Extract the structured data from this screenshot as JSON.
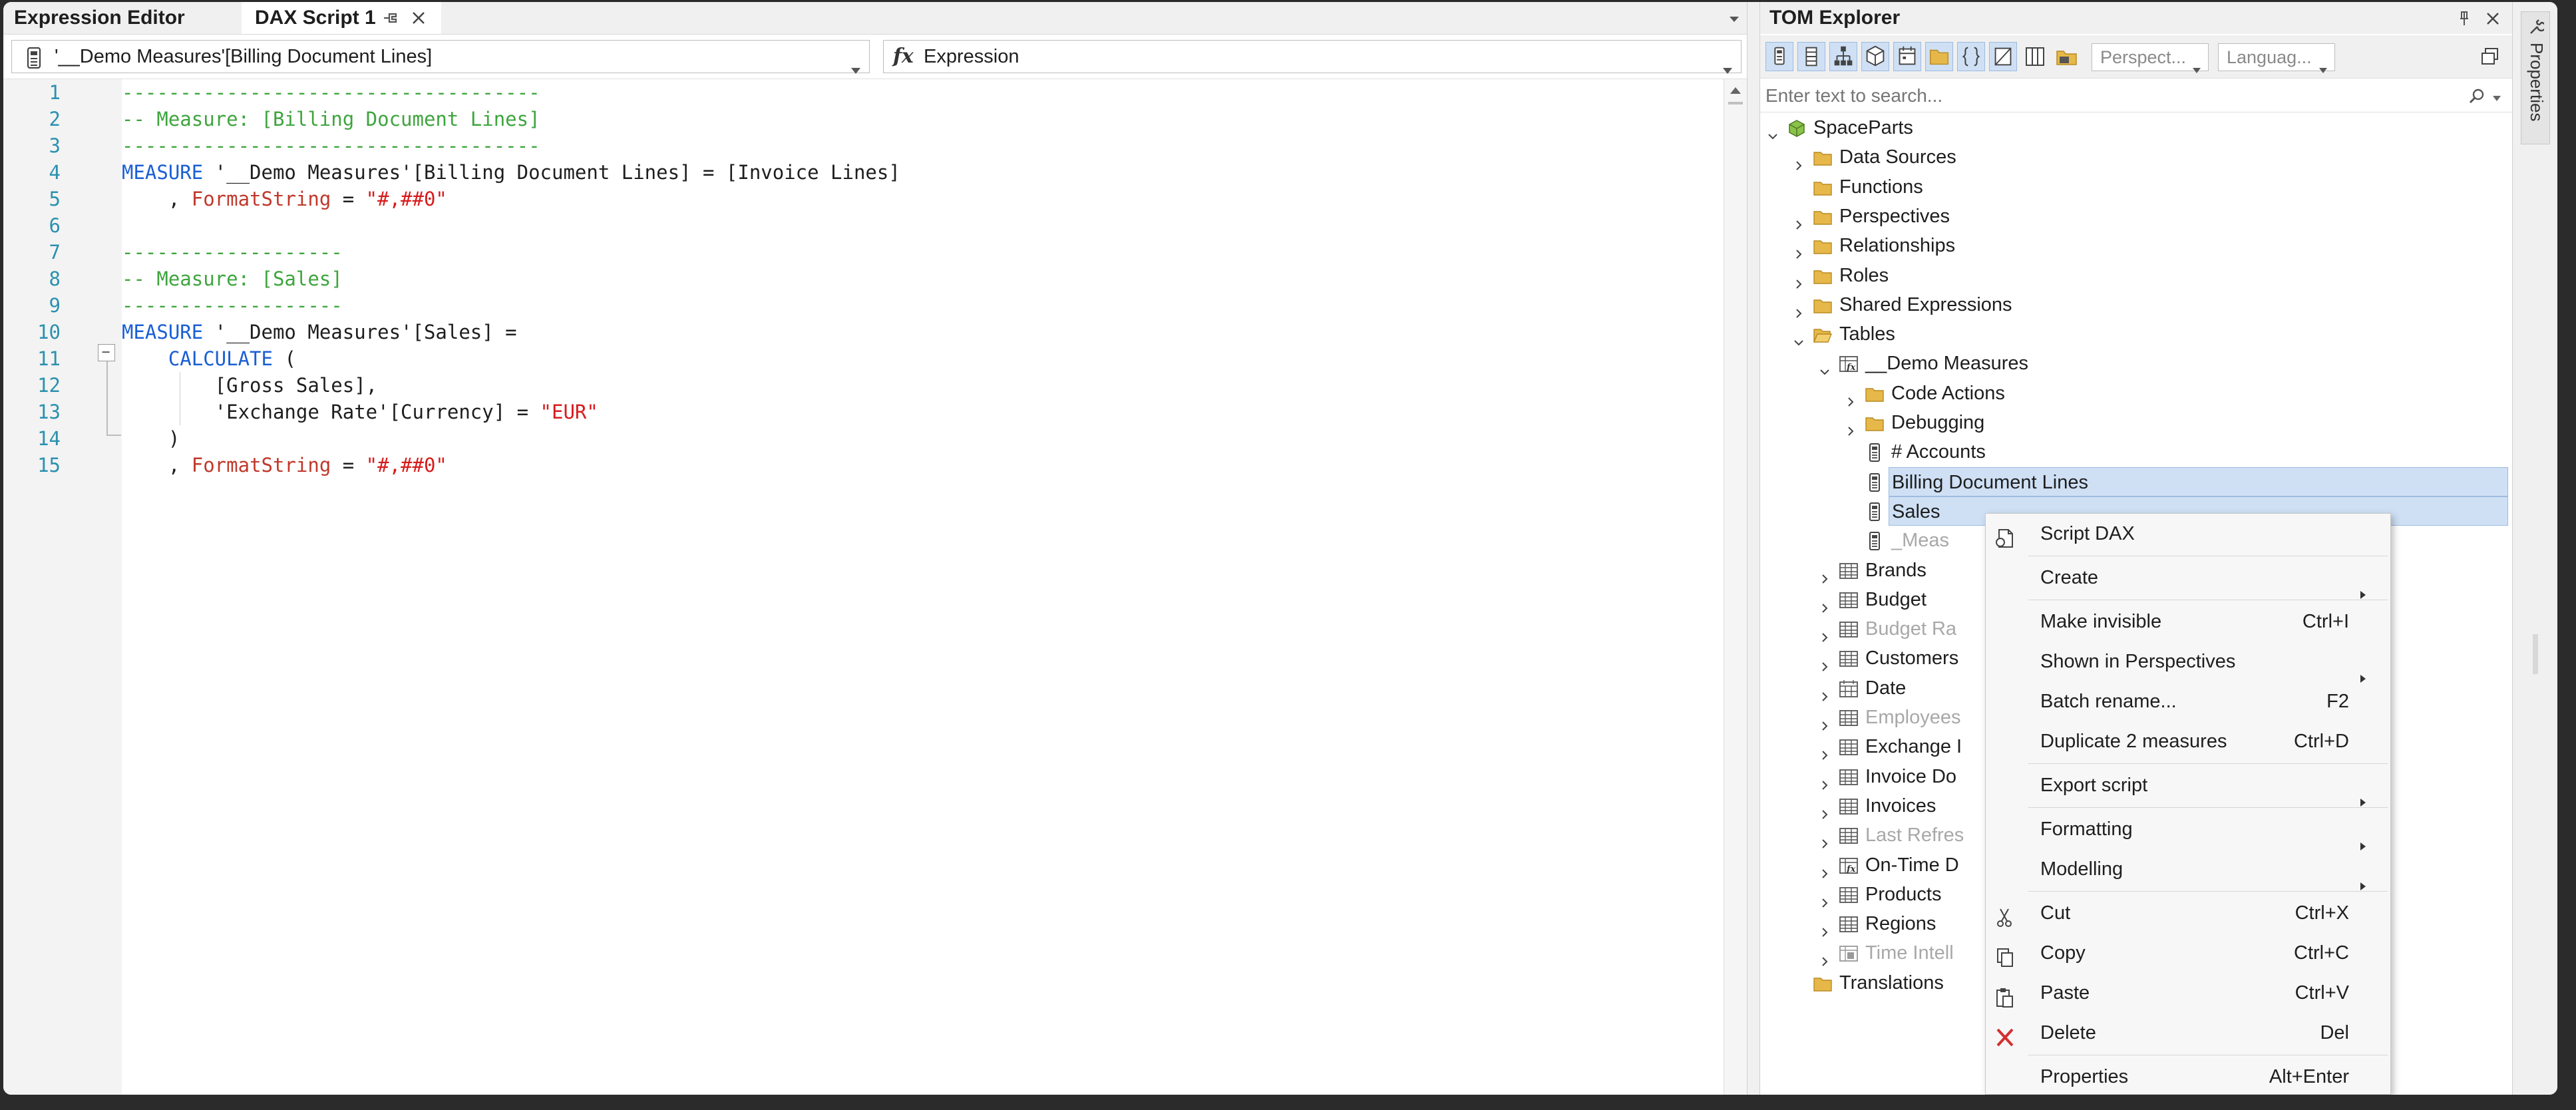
{
  "editor": {
    "tabs": [
      {
        "label": "Expression Editor"
      },
      {
        "label": "DAX Script 1"
      }
    ],
    "object_combo_value": "'__Demo Measures'[Billing Document Lines]",
    "property_combo_value": "Expression",
    "property_combo_icon": "fx"
  },
  "code": {
    "line_numbers": [
      "1",
      "2",
      "3",
      "4",
      "5",
      "6",
      "7",
      "8",
      "9",
      "10",
      "11",
      "12",
      "13",
      "14",
      "15"
    ],
    "lines": [
      [
        {
          "t": "------------------------------------",
          "c": "cm"
        }
      ],
      [
        {
          "t": "-- Measure: [Billing Document Lines]",
          "c": "cm"
        }
      ],
      [
        {
          "t": "------------------------------------",
          "c": "cm"
        }
      ],
      [
        {
          "t": "MEASURE",
          "c": "kw"
        },
        {
          "t": " '__Demo Measures'[Billing Document Lines] = [Invoice Lines]",
          "c": ""
        }
      ],
      [
        {
          "t": "    , ",
          "c": ""
        },
        {
          "t": "FormatString",
          "c": "prop"
        },
        {
          "t": " = ",
          "c": ""
        },
        {
          "t": "\"#,##0\"",
          "c": "str"
        }
      ],
      [
        {
          "t": "",
          "c": ""
        }
      ],
      [
        {
          "t": "-------------------",
          "c": "cm"
        }
      ],
      [
        {
          "t": "-- Measure: [Sales]",
          "c": "cm"
        }
      ],
      [
        {
          "t": "-------------------",
          "c": "cm"
        }
      ],
      [
        {
          "t": "MEASURE",
          "c": "kw"
        },
        {
          "t": " '__Demo Measures'[Sales] =",
          "c": ""
        }
      ],
      [
        {
          "t": "    ",
          "c": ""
        },
        {
          "t": "CALCULATE",
          "c": "fn"
        },
        {
          "t": " (",
          "c": ""
        }
      ],
      [
        {
          "t": "        [Gross Sales],",
          "c": ""
        }
      ],
      [
        {
          "t": "        'Exchange Rate'[Currency] = ",
          "c": ""
        },
        {
          "t": "\"EUR\"",
          "c": "str"
        }
      ],
      [
        {
          "t": "    )",
          "c": ""
        }
      ],
      [
        {
          "t": "    , ",
          "c": ""
        },
        {
          "t": "FormatString",
          "c": "prop"
        },
        {
          "t": " = ",
          "c": ""
        },
        {
          "t": "\"#,##0\"",
          "c": "str"
        }
      ]
    ]
  },
  "tom": {
    "title": "TOM Explorer",
    "perspective_placeholder": "Perspect...",
    "language_placeholder": "Languag...",
    "search_placeholder": "Enter text to search...",
    "tree": [
      {
        "label": "SpaceParts",
        "level": 0,
        "exp": "down",
        "icon": "model-icon"
      },
      {
        "label": "Data Sources",
        "level": 1,
        "exp": "right",
        "icon": "folder-icon"
      },
      {
        "label": "Functions",
        "level": 1,
        "exp": "",
        "icon": "folder-icon"
      },
      {
        "label": "Perspectives",
        "level": 1,
        "exp": "right",
        "icon": "folder-icon"
      },
      {
        "label": "Relationships",
        "level": 1,
        "exp": "right",
        "icon": "folder-icon"
      },
      {
        "label": "Roles",
        "level": 1,
        "exp": "right",
        "icon": "folder-icon"
      },
      {
        "label": "Shared Expressions",
        "level": 1,
        "exp": "right",
        "icon": "folder-icon"
      },
      {
        "label": "Tables",
        "level": 1,
        "exp": "down",
        "icon": "folder-open-icon"
      },
      {
        "label": "__Demo Measures",
        "level": 2,
        "exp": "down",
        "icon": "calc-table-icon"
      },
      {
        "label": "Code Actions",
        "level": 3,
        "exp": "right",
        "icon": "folder-icon"
      },
      {
        "label": "Debugging",
        "level": 3,
        "exp": "right",
        "icon": "folder-icon"
      },
      {
        "label": "# Accounts",
        "level": 3,
        "exp": "",
        "icon": "measure-icon"
      },
      {
        "label": "Billing Document Lines",
        "level": 3,
        "exp": "",
        "icon": "measure-icon",
        "selected": true
      },
      {
        "label": "Sales",
        "level": 3,
        "exp": "",
        "icon": "measure-icon",
        "selected": true
      },
      {
        "label": "_Meas",
        "level": 3,
        "exp": "",
        "icon": "measure-icon",
        "dim": true
      },
      {
        "label": "Brands",
        "level": 2,
        "exp": "right",
        "icon": "table-icon"
      },
      {
        "label": "Budget",
        "level": 2,
        "exp": "right",
        "icon": "table-icon"
      },
      {
        "label": "Budget Ra",
        "level": 2,
        "exp": "right",
        "icon": "table-icon",
        "dim": true
      },
      {
        "label": "Customers",
        "level": 2,
        "exp": "right",
        "icon": "table-icon"
      },
      {
        "label": "Date",
        "level": 2,
        "exp": "right",
        "icon": "date-table-icon"
      },
      {
        "label": "Employees",
        "level": 2,
        "exp": "right",
        "icon": "table-icon",
        "dim": true
      },
      {
        "label": "Exchange I",
        "level": 2,
        "exp": "right",
        "icon": "table-icon"
      },
      {
        "label": "Invoice Do",
        "level": 2,
        "exp": "right",
        "icon": "table-icon"
      },
      {
        "label": "Invoices",
        "level": 2,
        "exp": "right",
        "icon": "table-icon"
      },
      {
        "label": "Last Refres",
        "level": 2,
        "exp": "right",
        "icon": "table-icon",
        "dim": true
      },
      {
        "label": "On-Time D",
        "level": 2,
        "exp": "right",
        "icon": "calc-table-icon"
      },
      {
        "label": "Products",
        "level": 2,
        "exp": "right",
        "icon": "table-icon"
      },
      {
        "label": "Regions",
        "level": 2,
        "exp": "right",
        "icon": "table-icon"
      },
      {
        "label": "Time Intell",
        "level": 2,
        "exp": "right",
        "icon": "calc-group-icon",
        "dim": true
      },
      {
        "label": "Translations",
        "level": 1,
        "exp": "",
        "icon": "folder-icon"
      }
    ]
  },
  "side_strip": {
    "label": "Properties"
  },
  "context_menu": {
    "items": [
      {
        "label": "Script DAX",
        "key": "",
        "icon": "script-dax-icon",
        "submenu": false
      },
      {
        "sep": true
      },
      {
        "label": "Create",
        "key": "",
        "icon": "",
        "submenu": true
      },
      {
        "sep": true
      },
      {
        "label": "Make invisible",
        "key": "Ctrl+I",
        "icon": "",
        "submenu": false
      },
      {
        "label": "Shown in Perspectives",
        "key": "",
        "icon": "",
        "submenu": true
      },
      {
        "label": "Batch rename...",
        "key": "F2",
        "icon": "",
        "submenu": false
      },
      {
        "label": "Duplicate 2 measures",
        "key": "Ctrl+D",
        "icon": "",
        "submenu": false
      },
      {
        "sep": true
      },
      {
        "label": "Export script",
        "key": "",
        "icon": "",
        "submenu": true
      },
      {
        "sep": true
      },
      {
        "label": "Formatting",
        "key": "",
        "icon": "",
        "submenu": true
      },
      {
        "label": "Modelling",
        "key": "",
        "icon": "",
        "submenu": true
      },
      {
        "sep": true
      },
      {
        "label": "Cut",
        "key": "Ctrl+X",
        "icon": "cut-icon",
        "submenu": false
      },
      {
        "label": "Copy",
        "key": "Ctrl+C",
        "icon": "copy-icon",
        "submenu": false
      },
      {
        "label": "Paste",
        "key": "Ctrl+V",
        "icon": "paste-icon",
        "submenu": false
      },
      {
        "label": "Delete",
        "key": "Del",
        "icon": "delete-icon",
        "submenu": false
      },
      {
        "sep": true
      },
      {
        "label": "Properties",
        "key": "Alt+Enter",
        "icon": "",
        "submenu": false
      }
    ]
  },
  "colors": {
    "keyword": "#1a5fd4",
    "comment": "#3ea53e",
    "string": "#d81b1b",
    "selection": "#cfe0f5",
    "line_number": "#2b91af"
  }
}
